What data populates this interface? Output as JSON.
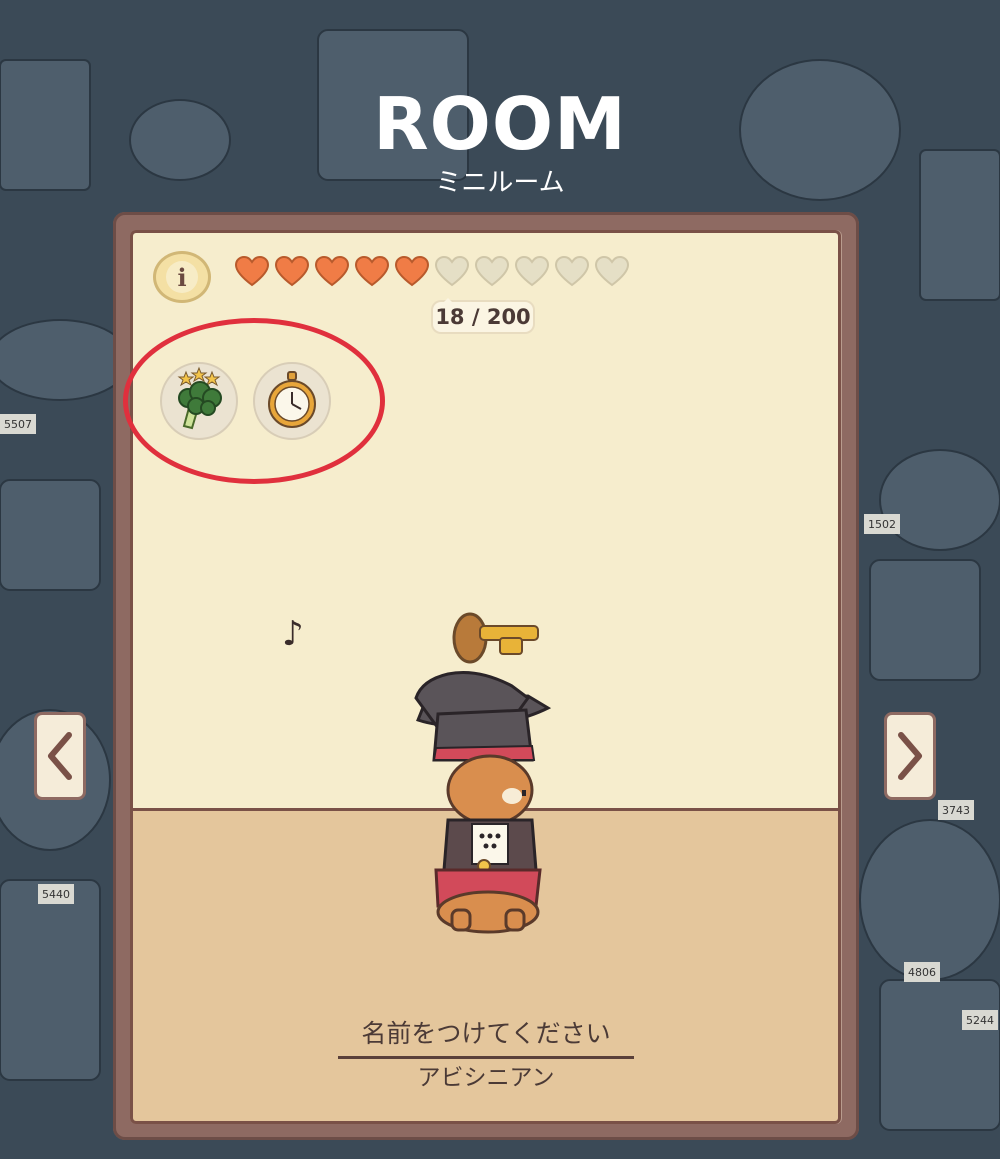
{
  "header": {
    "title": "ROOM",
    "subtitle": "ミニルーム"
  },
  "affection": {
    "hearts_total": 10,
    "hearts_filled": 5,
    "progress_text": "18 / 200",
    "filled_color": "#f07c46",
    "empty_color": "#e5dfc6"
  },
  "status_icons": [
    {
      "name": "broccoli-icon",
      "stars": 3
    },
    {
      "name": "stopwatch-icon"
    }
  ],
  "cat": {
    "name_placeholder": "名前をつけてください",
    "breed": "アビシニアン"
  },
  "background_signs": [
    "5507",
    "1502",
    "3743",
    "5440",
    "4806",
    "5244"
  ],
  "colors": {
    "highlight": "#e0303d",
    "panel": "#8e6a62",
    "wall": "#f6edcd",
    "floor": "#e4c69c"
  }
}
